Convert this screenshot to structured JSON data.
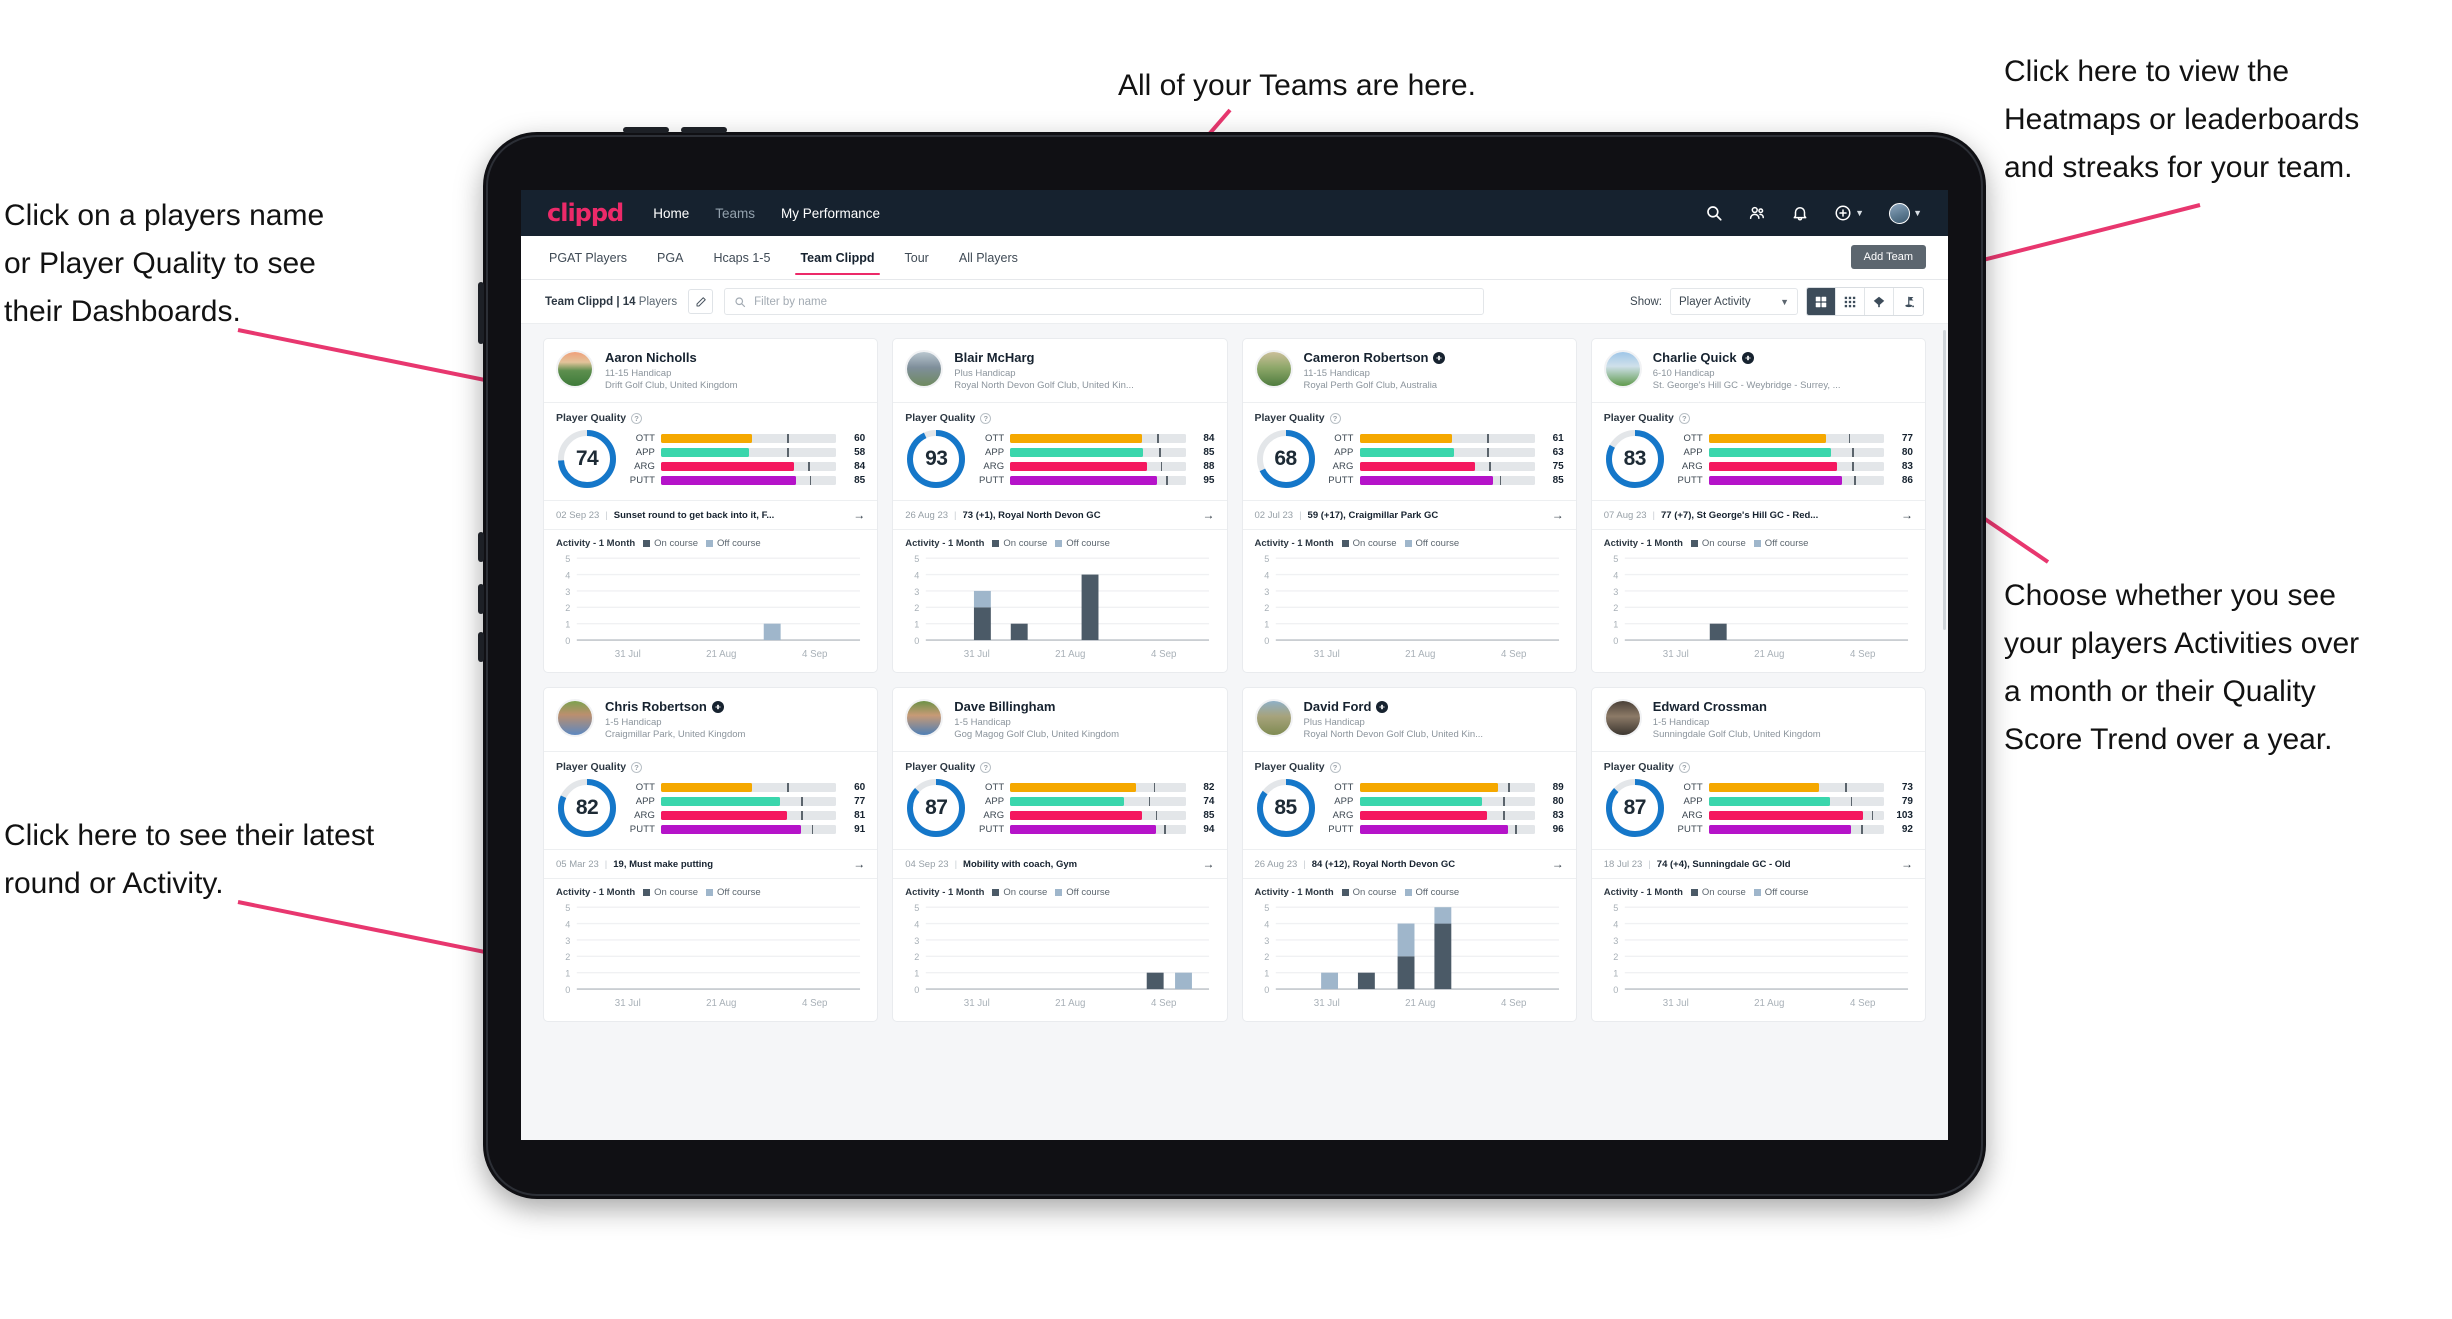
{
  "annotations": [
    {
      "id": "teams",
      "text": "All of your Teams are here."
    },
    {
      "id": "heatmaps",
      "text": "Click here to view the\nHeatmaps or leaderboards\nand streaks for your team."
    },
    {
      "id": "players-name",
      "text": "Click on a players name\nor Player Quality to see\ntheir Dashboards."
    },
    {
      "id": "show-toggle",
      "text": "Choose whether you see\nyour players Activities over\na month or their Quality\nScore Trend over a year."
    },
    {
      "id": "latest-round",
      "text": "Click here to see their latest\nround or Activity."
    }
  ],
  "app": {
    "brand": "clippd",
    "nav": [
      {
        "label": "Home",
        "active": true
      },
      {
        "label": "Teams",
        "active": false
      },
      {
        "label": "My Performance",
        "active": true
      }
    ],
    "icons": {
      "search": "search-icon",
      "people": "people-icon",
      "bell": "bell-icon",
      "plus": "plus-circle-icon",
      "avatar": "avatar"
    },
    "subtabs": [
      {
        "label": "PGAT Players",
        "active": false
      },
      {
        "label": "PGA",
        "active": false
      },
      {
        "label": "Hcaps 1-5",
        "active": false
      },
      {
        "label": "Team Clippd",
        "active": true
      },
      {
        "label": "Tour",
        "active": false
      },
      {
        "label": "All Players",
        "active": false
      }
    ],
    "add_team_label": "Add Team",
    "filterbar": {
      "team_name": "Team Clippd",
      "separator": "|",
      "player_count": "14",
      "players_word": "Players",
      "edit_icon": "pencil-icon",
      "search_placeholder": "Filter by name",
      "search_value": "",
      "show_label": "Show:",
      "show_value": "Player Activity",
      "show_options": [
        "Player Activity",
        "Quality Score Trend"
      ],
      "view_buttons": [
        {
          "name": "grid-view",
          "active": true
        },
        {
          "name": "dense-grid-view",
          "active": false
        },
        {
          "name": "heatmap-view",
          "active": false
        },
        {
          "name": "leaderboard-view",
          "active": false
        }
      ]
    }
  },
  "card_labels": {
    "player_quality": "Player Quality",
    "help": "?",
    "activity_title": "Activity - 1 Month",
    "legend_on": "On course",
    "legend_off": "Off course",
    "arrow": "→"
  },
  "colors": {
    "accent": "#ec2a69",
    "navbar": "#16222f",
    "ring": "#1577c9",
    "ott": "#f5a800",
    "app": "#3ad6ac",
    "arg": "#f4185f",
    "putt": "#b513c9",
    "on_course": "#4b5a67",
    "off_course": "#9fb6cb"
  },
  "chart_data": {
    "type": "bar",
    "title": "Activity - 1 Month",
    "ylabel": "",
    "xlabel": "",
    "ylim": [
      0,
      5
    ],
    "yticks": [
      0,
      1,
      2,
      3,
      4,
      5
    ],
    "xticks": [
      "31 Jul",
      "21 Aug",
      "4 Sep"
    ],
    "stacked": true,
    "series_names": [
      "On course",
      "Off course"
    ],
    "per_player": [
      {
        "player": "Aaron Nicholls",
        "bars": [
          {
            "pos": 0.66,
            "on": 0,
            "off": 1
          }
        ]
      },
      {
        "player": "Blair McHarg",
        "bars": [
          {
            "pos": 0.17,
            "on": 2,
            "off": 1
          },
          {
            "pos": 0.3,
            "on": 1,
            "off": 0
          },
          {
            "pos": 0.55,
            "on": 4,
            "off": 0
          }
        ]
      },
      {
        "player": "Cameron Robertson",
        "bars": []
      },
      {
        "player": "Charlie Quick",
        "bars": [
          {
            "pos": 0.3,
            "on": 1,
            "off": 0
          }
        ]
      },
      {
        "player": "Chris Robertson",
        "bars": []
      },
      {
        "player": "Dave Billingham",
        "bars": [
          {
            "pos": 0.78,
            "on": 1,
            "off": 0
          },
          {
            "pos": 0.88,
            "on": 0,
            "off": 1
          }
        ]
      },
      {
        "player": "David Ford",
        "bars": [
          {
            "pos": 0.16,
            "on": 0,
            "off": 1
          },
          {
            "pos": 0.29,
            "on": 1,
            "off": 0
          },
          {
            "pos": 0.43,
            "on": 2,
            "off": 2
          },
          {
            "pos": 0.56,
            "on": 4,
            "off": 1
          }
        ]
      },
      {
        "player": "Edward Crossman",
        "bars": []
      }
    ]
  },
  "players": [
    {
      "name": "Aaron Nicholls",
      "verified": false,
      "handicap": "11-15 Handicap",
      "club": "Drift Golf Club, United Kingdom",
      "score": "74",
      "ring_pct": 74,
      "metrics": [
        {
          "label": "OTT",
          "value": "60",
          "fill": 52,
          "tick": 72
        },
        {
          "label": "APP",
          "value": "58",
          "fill": 50,
          "tick": 72
        },
        {
          "label": "ARG",
          "value": "84",
          "fill": 76,
          "tick": 84
        },
        {
          "label": "PUTT",
          "value": "85",
          "fill": 77,
          "tick": 85
        }
      ],
      "latest_date": "02 Sep 23",
      "latest_text": "Sunset round to get back into it, F...",
      "avatar_kind": "sunset-course"
    },
    {
      "name": "Blair McHarg",
      "verified": false,
      "handicap": "Plus Handicap",
      "club": "Royal North Devon Golf Club, United Kin...",
      "score": "93",
      "ring_pct": 93,
      "metrics": [
        {
          "label": "OTT",
          "value": "84",
          "fill": 75,
          "tick": 84
        },
        {
          "label": "APP",
          "value": "85",
          "fill": 76,
          "tick": 85
        },
        {
          "label": "ARG",
          "value": "88",
          "fill": 78,
          "tick": 86
        },
        {
          "label": "PUTT",
          "value": "95",
          "fill": 84,
          "tick": 89
        }
      ],
      "latest_date": "26 Aug 23",
      "latest_text": "73 (+1), Royal North Devon GC",
      "avatar_kind": "links"
    },
    {
      "name": "Cameron Robertson",
      "verified": true,
      "handicap": "11-15 Handicap",
      "club": "Royal Perth Golf Club, Australia",
      "score": "68",
      "ring_pct": 68,
      "metrics": [
        {
          "label": "OTT",
          "value": "61",
          "fill": 53,
          "tick": 73
        },
        {
          "label": "APP",
          "value": "63",
          "fill": 54,
          "tick": 73
        },
        {
          "label": "ARG",
          "value": "75",
          "fill": 66,
          "tick": 74
        },
        {
          "label": "PUTT",
          "value": "85",
          "fill": 76,
          "tick": 80
        }
      ],
      "latest_date": "02 Jul 23",
      "latest_text": "59 (+17), Craigmillar Park GC",
      "avatar_kind": "fairway"
    },
    {
      "name": "Charlie Quick",
      "verified": true,
      "handicap": "6-10 Handicap",
      "club": "St. George's Hill GC - Weybridge - Surrey, ...",
      "score": "83",
      "ring_pct": 83,
      "metrics": [
        {
          "label": "OTT",
          "value": "77",
          "fill": 67,
          "tick": 80
        },
        {
          "label": "APP",
          "value": "80",
          "fill": 70,
          "tick": 82
        },
        {
          "label": "ARG",
          "value": "83",
          "fill": 73,
          "tick": 82
        },
        {
          "label": "PUTT",
          "value": "86",
          "fill": 76,
          "tick": 83
        }
      ],
      "latest_date": "07 Aug 23",
      "latest_text": "77 (+7), St George's Hill GC - Red...",
      "avatar_kind": "green"
    },
    {
      "name": "Chris Robertson",
      "verified": true,
      "handicap": "1-5 Handicap",
      "club": "Craigmillar Park, United Kingdom",
      "score": "82",
      "ring_pct": 82,
      "metrics": [
        {
          "label": "OTT",
          "value": "60",
          "fill": 52,
          "tick": 72
        },
        {
          "label": "APP",
          "value": "77",
          "fill": 68,
          "tick": 80
        },
        {
          "label": "ARG",
          "value": "81",
          "fill": 72,
          "tick": 80
        },
        {
          "label": "PUTT",
          "value": "91",
          "fill": 80,
          "tick": 86
        }
      ],
      "latest_date": "05 Mar 23",
      "latest_text": "19, Must make putting",
      "avatar_kind": "person-a"
    },
    {
      "name": "Dave Billingham",
      "verified": false,
      "handicap": "1-5 Handicap",
      "club": "Gog Magog Golf Club, United Kingdom",
      "score": "87",
      "ring_pct": 87,
      "metrics": [
        {
          "label": "OTT",
          "value": "82",
          "fill": 72,
          "tick": 82
        },
        {
          "label": "APP",
          "value": "74",
          "fill": 65,
          "tick": 79
        },
        {
          "label": "ARG",
          "value": "85",
          "fill": 75,
          "tick": 83
        },
        {
          "label": "PUTT",
          "value": "94",
          "fill": 83,
          "tick": 88
        }
      ],
      "latest_date": "04 Sep 23",
      "latest_text": "Mobility with coach, Gym",
      "avatar_kind": "person-b"
    },
    {
      "name": "David Ford",
      "verified": true,
      "handicap": "Plus Handicap",
      "club": "Royal North Devon Golf Club, United Kin...",
      "score": "85",
      "ring_pct": 85,
      "metrics": [
        {
          "label": "OTT",
          "value": "89",
          "fill": 79,
          "tick": 85
        },
        {
          "label": "APP",
          "value": "80",
          "fill": 70,
          "tick": 82
        },
        {
          "label": "ARG",
          "value": "83",
          "fill": 73,
          "tick": 82
        },
        {
          "label": "PUTT",
          "value": "96",
          "fill": 85,
          "tick": 89
        }
      ],
      "latest_date": "26 Aug 23",
      "latest_text": "84 (+12), Royal North Devon GC",
      "avatar_kind": "hiker"
    },
    {
      "name": "Edward Crossman",
      "verified": false,
      "handicap": "1-5 Handicap",
      "club": "Sunningdale Golf Club, United Kingdom",
      "score": "87",
      "ring_pct": 87,
      "metrics": [
        {
          "label": "OTT",
          "value": "73",
          "fill": 63,
          "tick": 78
        },
        {
          "label": "APP",
          "value": "79",
          "fill": 69,
          "tick": 81
        },
        {
          "label": "ARG",
          "value": "103",
          "fill": 88,
          "tick": 93
        },
        {
          "label": "PUTT",
          "value": "92",
          "fill": 81,
          "tick": 87
        }
      ],
      "latest_date": "18 Jul 23",
      "latest_text": "74 (+4), Sunningdale GC - Old",
      "avatar_kind": "indoor"
    }
  ]
}
